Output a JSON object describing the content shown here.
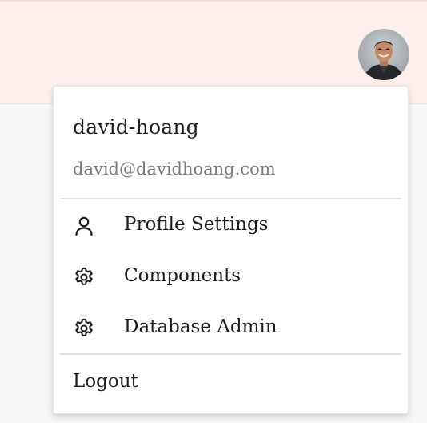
{
  "user": {
    "name": "david-hoang",
    "email": "david@davidhoang.com"
  },
  "header": {
    "avatar_icon": "avatar"
  },
  "menu": {
    "items": [
      {
        "label": "Profile Settings",
        "icon": "user-icon"
      },
      {
        "label": "Components",
        "icon": "gear-icon"
      },
      {
        "label": "Database Admin",
        "icon": "gear-icon"
      }
    ],
    "logout_label": "Logout"
  },
  "colors": {
    "header_bg": "#fdf0ec",
    "page_bg": "#f7f7f7",
    "text": "#1c1c1c",
    "muted_text": "#7a7a7a"
  }
}
